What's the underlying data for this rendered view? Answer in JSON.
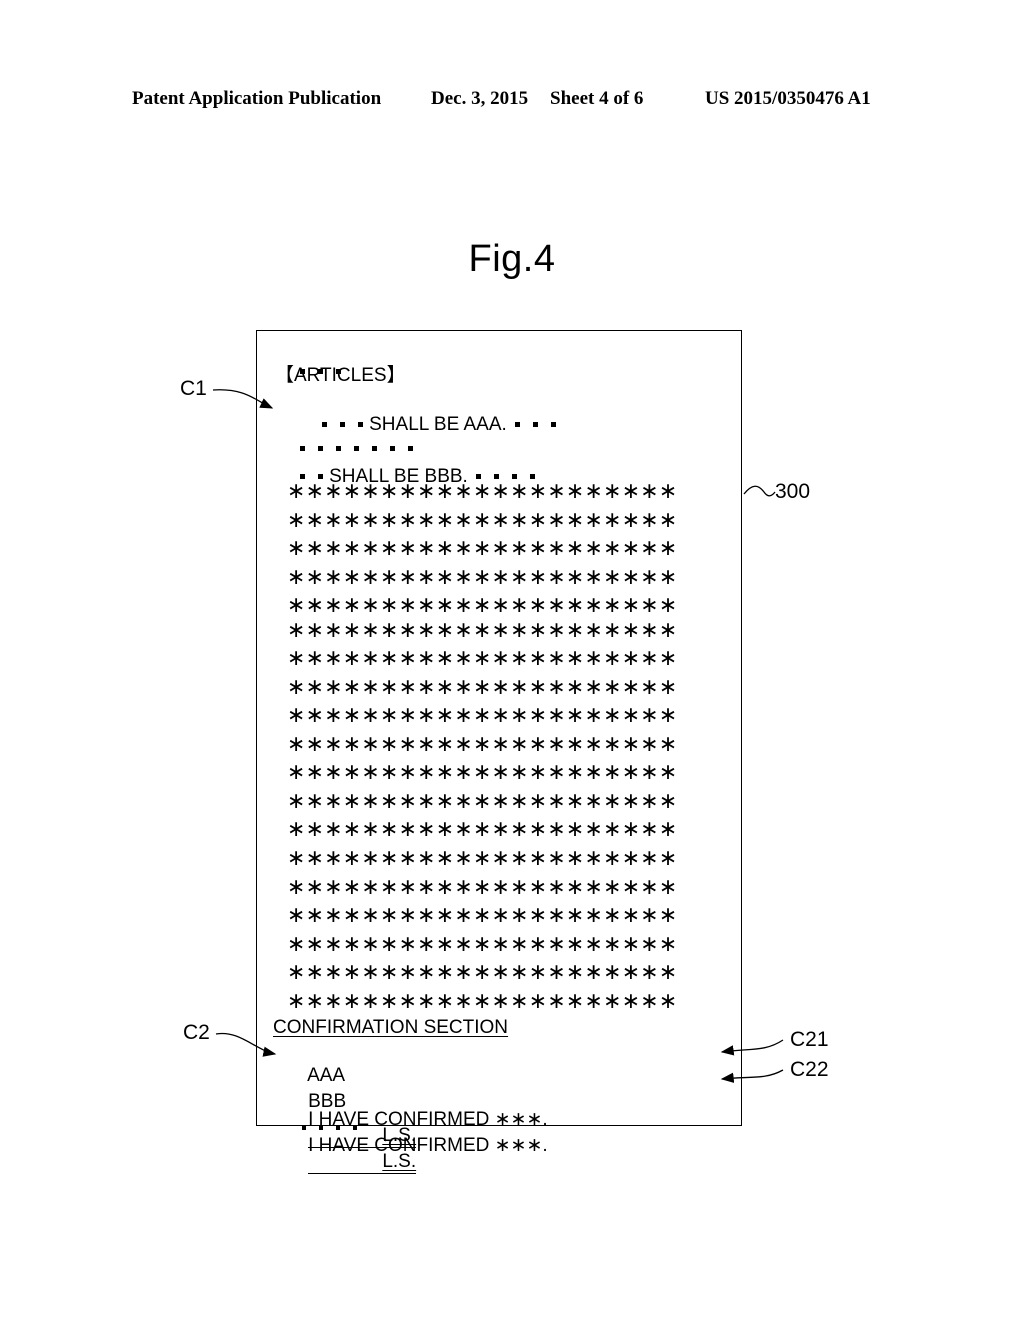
{
  "header": {
    "publication": "Patent Application Publication",
    "date": "Dec. 3, 2015",
    "sheet": "Sheet 4 of 6",
    "number": "US 2015/0350476 A1"
  },
  "figure": {
    "title": "Fig.4",
    "reference_numerals": {
      "document": "300",
      "c1": "C1",
      "c2": "C2",
      "c21": "C21",
      "c22": "C22"
    }
  },
  "document": {
    "articles_heading": "【ARTICLES】",
    "clause_aaa": "SHALL BE AAA.",
    "clause_bbb": "SHALL BE BBB.",
    "asterisk_rows": 19,
    "asterisks_per_row": 21,
    "asterisk_char": "∗",
    "confirmation_heading": "CONFIRMATION SECTION",
    "confirmations": [
      {
        "party": "AAA",
        "text": "I HAVE CONFIRMED ∗∗∗.",
        "seal": "L.S."
      },
      {
        "party": "BBB",
        "text": "I HAVE CONFIRMED ∗∗∗.",
        "seal": "L.S."
      }
    ]
  }
}
